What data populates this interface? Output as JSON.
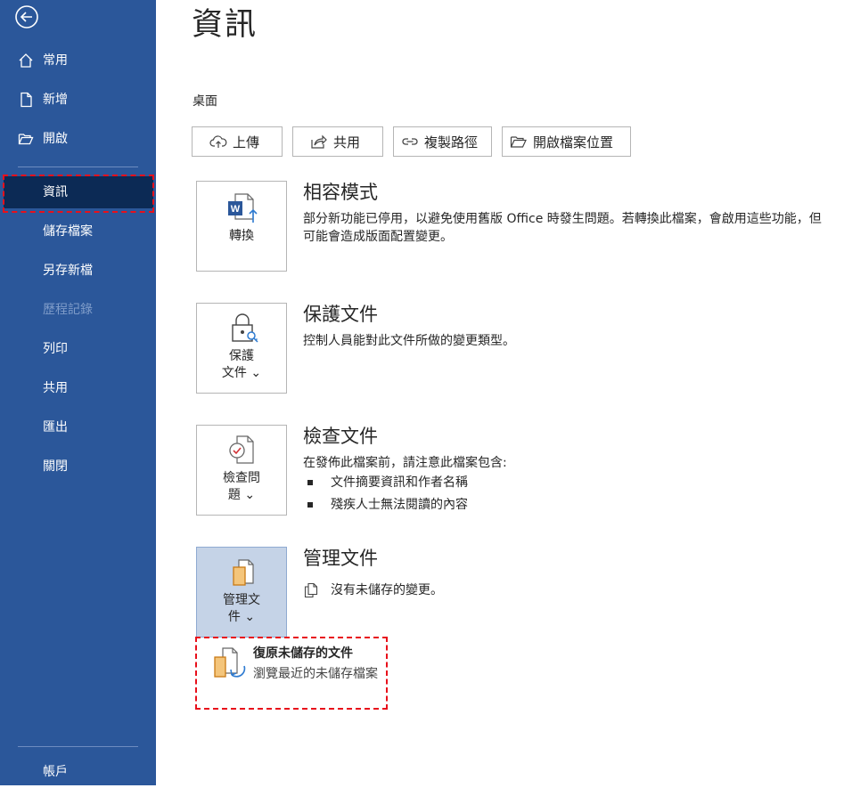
{
  "sidebar": {
    "items": [
      {
        "label": "常用",
        "icon": "home-icon"
      },
      {
        "label": "新增",
        "icon": "new-document-icon"
      },
      {
        "label": "開啟",
        "icon": "folder-open-icon"
      },
      {
        "label": "資訊",
        "selected": true
      },
      {
        "label": "儲存檔案"
      },
      {
        "label": "另存新檔"
      },
      {
        "label": "歷程記錄",
        "disabled": true
      },
      {
        "label": "列印"
      },
      {
        "label": "共用"
      },
      {
        "label": "匯出"
      },
      {
        "label": "關閉"
      }
    ],
    "account": "帳戶"
  },
  "main": {
    "title": "資訊",
    "location": "桌面",
    "actions": [
      {
        "label": "上傳",
        "icon": "cloud-upload-icon"
      },
      {
        "label": "共用",
        "icon": "share-icon"
      },
      {
        "label": "複製路徑",
        "icon": "link-icon"
      },
      {
        "label": "開啟檔案位置",
        "icon": "folder-open-icon"
      }
    ],
    "sections": {
      "compat": {
        "tile_label": "轉換",
        "title": "相容模式",
        "desc": "部分新功能已停用，以避免使用舊版 Office 時發生問題。若轉換此檔案，會啟用這些功能，但可能會造成版面配置變更。"
      },
      "protect": {
        "tile_line1": "保護",
        "tile_line2": "文件",
        "title": "保護文件",
        "desc": "控制人員能對此文件所做的變更類型。"
      },
      "inspect": {
        "tile_line1": "檢查問",
        "tile_line2": "題",
        "title": "檢查文件",
        "desc": "在發佈此檔案前，請注意此檔案包含:",
        "bullets": [
          "文件摘要資訊和作者名稱",
          "殘疾人士無法閱讀的內容"
        ]
      },
      "manage": {
        "tile_line1": "管理文",
        "tile_line2": "件",
        "title": "管理文件",
        "status": "沒有未儲存的變更。"
      }
    },
    "dropdown": {
      "title": "復原未儲存的文件",
      "desc": "瀏覽最近的未儲存檔案"
    }
  },
  "colors": {
    "sidebar_bg": "#2b579a",
    "sidebar_selected": "#0c2a55",
    "highlight_dashed": "#e8101b",
    "word_blue": "#2b579a",
    "accent_orange": "#e9a23b"
  }
}
